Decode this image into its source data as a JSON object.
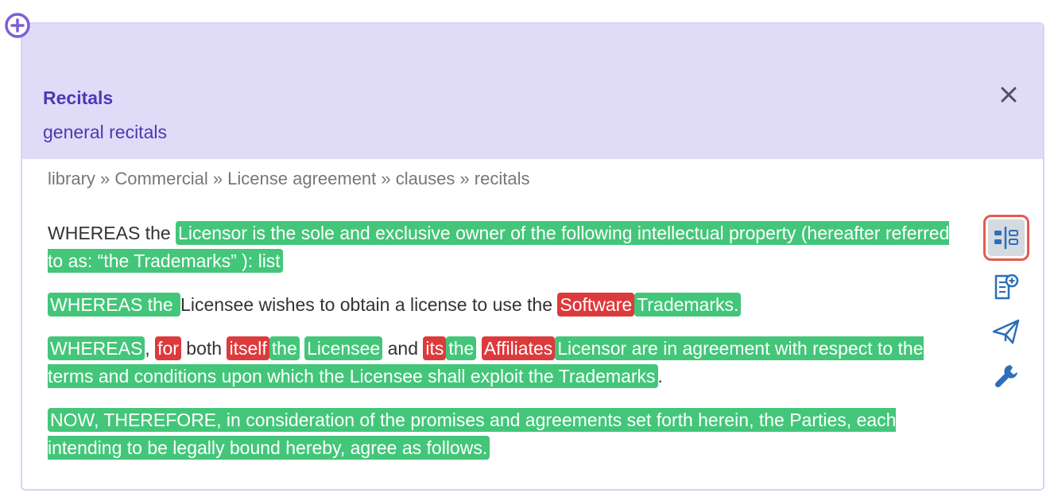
{
  "header": {
    "title": "Recitals",
    "subtitle": "general recitals"
  },
  "breadcrumb": "library » Commercial » License agreement » clauses » recitals",
  "paragraphs": [
    [
      {
        "t": "WHEREAS the ",
        "h": ""
      },
      {
        "t": "Licensor is the sole and exclusive owner of the following intellectual property (hereafter referred to as: “the Trademarks” ): list",
        "h": "g"
      }
    ],
    [
      {
        "t": "WHEREAS the ",
        "h": "g"
      },
      {
        "t": "Licensee wishes to obtain a license to use the ",
        "h": ""
      },
      {
        "t": "Software",
        "h": "r"
      },
      {
        "t": "Trademarks.",
        "h": "g"
      }
    ],
    [
      {
        "t": "WHEREAS",
        "h": "g"
      },
      {
        "t": ", ",
        "h": ""
      },
      {
        "t": "for",
        "h": "r"
      },
      {
        "t": " both ",
        "h": ""
      },
      {
        "t": "itself",
        "h": "r"
      },
      {
        "t": "the",
        "h": "g"
      },
      {
        "t": " ",
        "h": ""
      },
      {
        "t": "Licensee",
        "h": "g"
      },
      {
        "t": " and ",
        "h": ""
      },
      {
        "t": "its",
        "h": "r"
      },
      {
        "t": "the",
        "h": "g"
      },
      {
        "t": " ",
        "h": ""
      },
      {
        "t": "Affiliates",
        "h": "r"
      },
      {
        "t": "Licensor are in agreement with respect to the terms and conditions upon which the Licensee shall exploit the Trademarks",
        "h": "g"
      },
      {
        "t": ".",
        "h": ""
      }
    ],
    [
      {
        "t": "NOW, THEREFORE, in consideration of the promises and agreements set forth herein, the Parties, each intending to be legally bound hereby, agree as follows.",
        "h": "g"
      }
    ]
  ],
  "toolbar": [
    {
      "icon": "compare-layout-icon",
      "active": true
    },
    {
      "icon": "add-document-icon",
      "active": false
    },
    {
      "icon": "send-icon",
      "active": false
    },
    {
      "icon": "wrench-icon",
      "active": false
    }
  ],
  "colors": {
    "accent": "#4d38b5",
    "header_bg": "#e0dcf8",
    "highlight_green": "#43c679",
    "highlight_red": "#dd3a3c",
    "toolbar_icon": "#2b6fb8",
    "active_outline": "#e65a4f"
  }
}
